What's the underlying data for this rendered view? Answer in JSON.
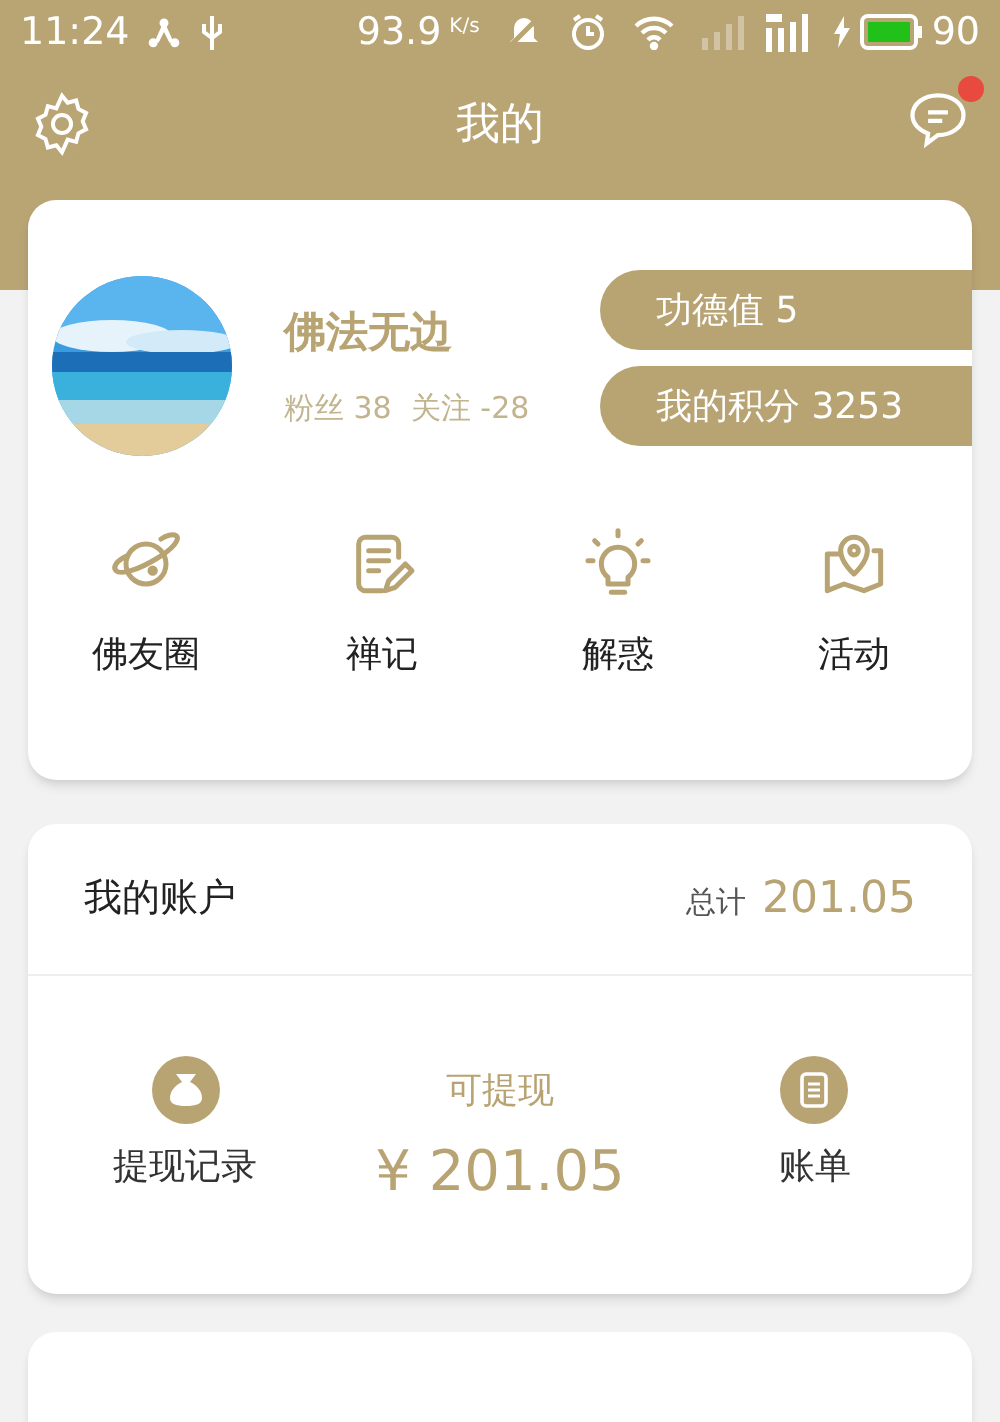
{
  "status_bar": {
    "time": "11:24",
    "speed": "93.9",
    "speed_unit": "K/s",
    "battery": "90"
  },
  "header": {
    "title": "我的",
    "message_badge": true
  },
  "profile": {
    "name": "佛法无边",
    "stats": "粉丝 38  关注 -28",
    "merit": "功德值 5",
    "points": "我的积分 3253"
  },
  "shortcuts": [
    {
      "kind": "planet",
      "label": "佛友圈"
    },
    {
      "kind": "note",
      "label": "禅记"
    },
    {
      "kind": "bulb",
      "label": "解惑"
    },
    {
      "kind": "map",
      "label": "活动"
    }
  ],
  "account": {
    "title": "我的账户",
    "total_label": "总计",
    "total": "201.05",
    "withdraw_records": "提现记录",
    "available_label": "可提现",
    "available": "¥ 201.05",
    "bill": "账单"
  }
}
